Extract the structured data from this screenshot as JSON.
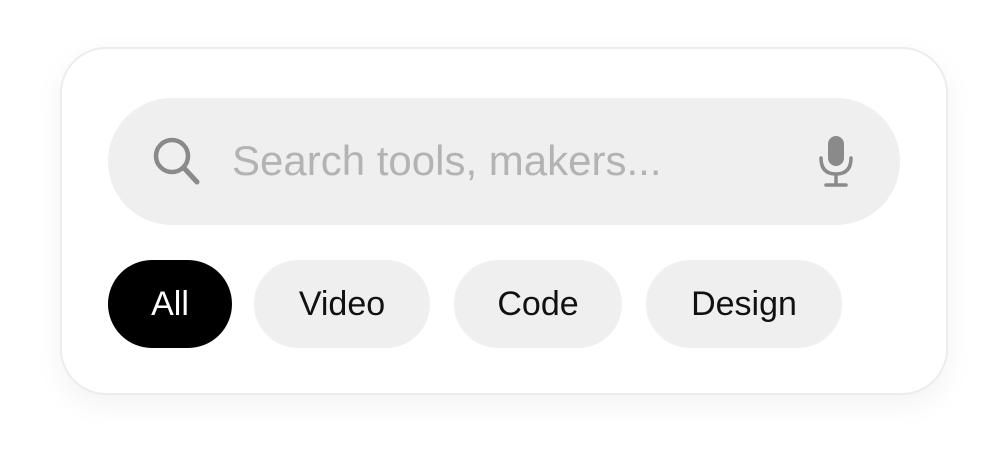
{
  "search": {
    "placeholder": "Search tools, makers...",
    "value": "",
    "icon": "search-icon",
    "mic_icon": "microphone-icon"
  },
  "filters": {
    "selected": "All",
    "items": [
      {
        "label": "All",
        "active": true
      },
      {
        "label": "Video",
        "active": false
      },
      {
        "label": "Code",
        "active": false
      },
      {
        "label": "Design",
        "active": false
      }
    ]
  },
  "colors": {
    "card_bg": "#ffffff",
    "search_bg": "#efefef",
    "chip_bg": "#efefef",
    "chip_active_bg": "#000000",
    "chip_active_text": "#ffffff",
    "chip_text": "#111111",
    "placeholder": "#b3b3b3",
    "icon": "#8a8a8a"
  }
}
